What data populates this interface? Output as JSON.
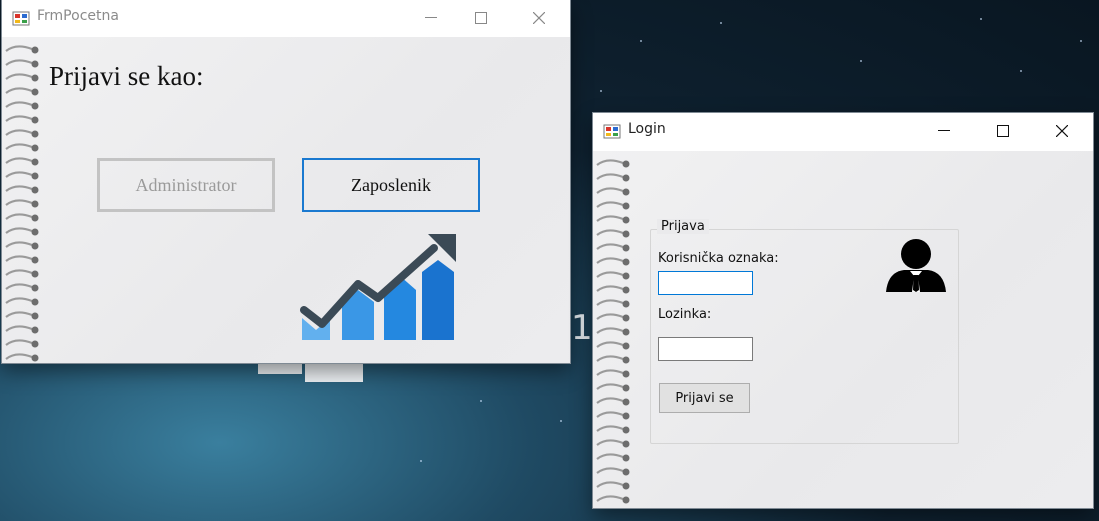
{
  "desktop": {
    "stray_digit": "1"
  },
  "frm_pocetna": {
    "title": "FrmPocetna",
    "heading": "Prijavi se kao:",
    "admin_button": "Administrator",
    "employee_button": "Zaposlenik",
    "chart_icon": "growth-chart-icon",
    "colors": {
      "bar_light": "#62b0ee",
      "bar_mid": "#3a97e6",
      "bar_dark": "#1a73cf",
      "arrow": "#3b4a56"
    }
  },
  "login": {
    "title": "Login",
    "group_title": "Prijava",
    "username_label": "Korisnička oznaka:",
    "username_value": "",
    "password_label": "Lozinka:",
    "password_value": "",
    "submit_label": "Prijavi se",
    "avatar_icon": "user-tie-icon"
  },
  "window_controls": {
    "minimize_icon": "minimize-icon",
    "maximize_icon": "maximize-icon",
    "close_icon": "close-icon"
  }
}
